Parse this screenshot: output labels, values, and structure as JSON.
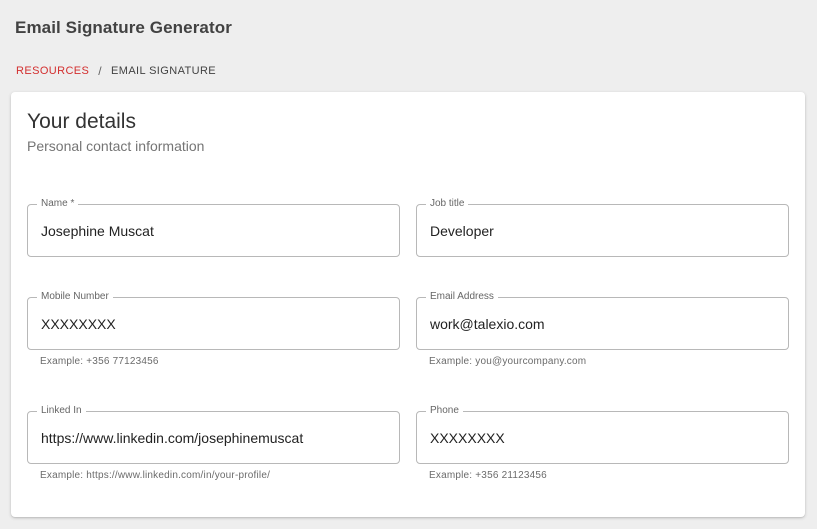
{
  "header": {
    "title": "Email Signature Generator"
  },
  "breadcrumb": {
    "items": [
      "RESOURCES",
      "EMAIL SIGNATURE"
    ],
    "separator": "/"
  },
  "card": {
    "title": "Your details",
    "subtitle": "Personal contact information"
  },
  "form": {
    "name": {
      "label": "Name *",
      "value": "Josephine Muscat"
    },
    "job_title": {
      "label": "Job title",
      "value": "Developer"
    },
    "mobile": {
      "label": "Mobile Number",
      "value": "XXXXXXXX",
      "hint": "Example: +356 77123456"
    },
    "email": {
      "label": "Email Address",
      "value": "work@talexio.com",
      "hint": "Example: you@yourcompany.com"
    },
    "linkedin": {
      "label": "Linked In",
      "value": "https://www.linkedin.com/josephinemuscat",
      "hint": "Example: https://www.linkedin.com/in/your-profile/"
    },
    "phone": {
      "label": "Phone",
      "value": "XXXXXXXX",
      "hint": "Example: +356 21123456"
    }
  },
  "colors": {
    "accent": "#d32f2f",
    "background": "#eeeeee",
    "card": "#ffffff"
  }
}
